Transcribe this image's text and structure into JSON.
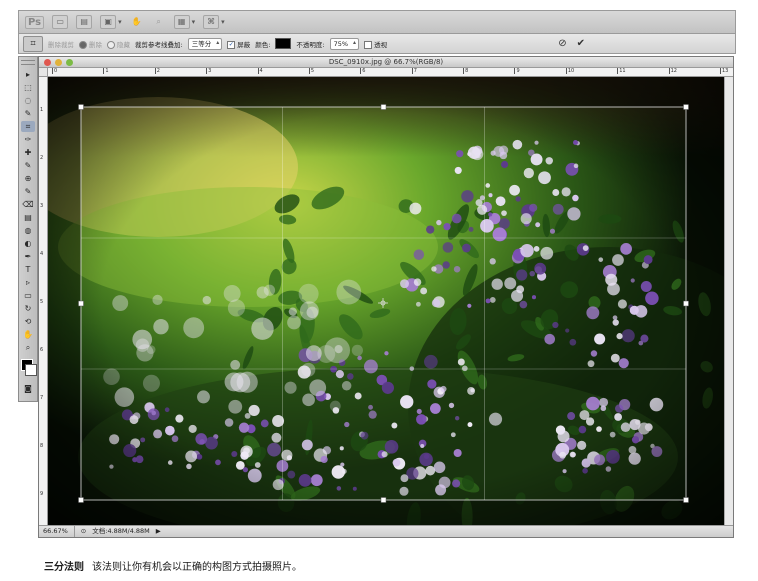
{
  "appbar": {
    "logo": "Ps",
    "icons": [
      "bridge-icon",
      "minibridge-icon",
      "screen-mode-icon",
      "hand-icon",
      "zoom-icon",
      "arrange-icon",
      "extras-icon"
    ]
  },
  "options": {
    "tool_icon": "crop-icon",
    "delete_label": "删除裁剪",
    "radio_delete": "删除",
    "radio_hide": "隐藏",
    "overlay_label": "裁剪参考线叠加:",
    "overlay_value": "三等分",
    "shield_label": "屏蔽",
    "color_label": "颜色:",
    "opacity_label": "不透明度:",
    "opacity_value": "75%",
    "perspective_label": "透视",
    "cancel_icon": "cancel-icon",
    "commit_icon": "commit-checkmark-icon"
  },
  "toolbox": {
    "tools": [
      "move-tool-icon",
      "marquee-tool-icon",
      "lasso-tool-icon",
      "quick-select-tool-icon",
      "crop-tool-icon",
      "eyedropper-tool-icon",
      "healing-brush-tool-icon",
      "brush-tool-icon",
      "clone-stamp-tool-icon",
      "history-brush-tool-icon",
      "eraser-tool-icon",
      "gradient-tool-icon",
      "blur-tool-icon",
      "dodge-tool-icon",
      "pen-tool-icon",
      "type-tool-icon",
      "path-select-tool-icon",
      "shape-tool-icon",
      "3d-rotate-tool-icon",
      "3d-orbit-tool-icon",
      "hand-tool-icon",
      "zoom-tool-icon"
    ],
    "glyphs": [
      "▸",
      "⬚",
      "◌",
      "✎",
      "⌗",
      "✑",
      "✚",
      "✎",
      "⊕",
      "✎",
      "⌫",
      "▤",
      "◍",
      "◐",
      "✒",
      "T",
      "▹",
      "▭",
      "↻",
      "⟲",
      "✋",
      "⌕"
    ]
  },
  "document": {
    "title": "DSC_0910x.jpg @ 66.7%(RGB/8)",
    "ruler_top": [
      "0",
      "1",
      "2",
      "3",
      "4",
      "5",
      "6",
      "7",
      "8",
      "9",
      "10",
      "11",
      "12",
      "13"
    ],
    "ruler_left": [
      "1",
      "2",
      "3",
      "4",
      "5",
      "6",
      "7",
      "8",
      "9"
    ],
    "zoom": "66.67%",
    "doc_size": "文档:4.88M/4.88M"
  },
  "caption": {
    "title": "三分法则",
    "text": "该法则让你有机会以正确的构图方式拍摄照片。"
  }
}
